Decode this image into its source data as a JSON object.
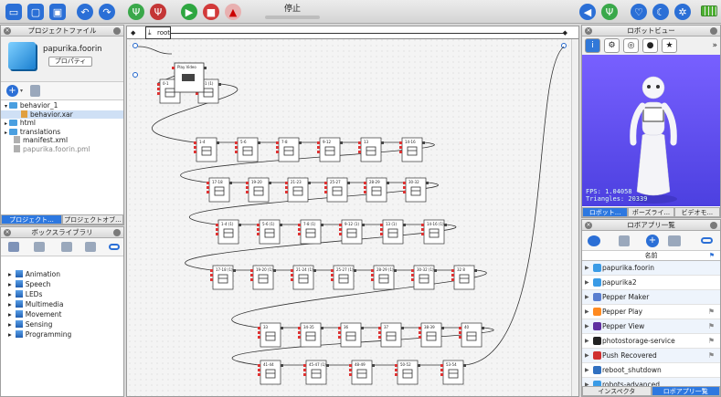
{
  "toolbar": {
    "status_label": "停止",
    "icons": [
      "new-icon",
      "open-icon",
      "save-icon",
      "undo-icon",
      "redo-icon",
      "connect-icon",
      "disconnect-icon",
      "play-icon",
      "stop-icon",
      "warning-icon",
      "volume-icon",
      "robot-icon",
      "heart-icon",
      "sleep-icon",
      "settings-icon",
      "battery-icon"
    ]
  },
  "project_panel": {
    "title": "プロジェクトファイル",
    "name": "papurika.foorin",
    "properties_button": "プロパティ",
    "tree": [
      {
        "label": "behavior_1",
        "type": "folder"
      },
      {
        "label": "behavior.xar",
        "type": "file",
        "selected": true
      },
      {
        "label": "html",
        "type": "folder"
      },
      {
        "label": "translations",
        "type": "folder"
      },
      {
        "label": "manifest.xml",
        "type": "file"
      },
      {
        "label": "papurika.foorin.pml",
        "type": "file"
      }
    ],
    "tabs": [
      "プロジェクト...",
      "プロジェクトオブ..."
    ]
  },
  "box_library": {
    "title": "ボックスライブラリ",
    "items": [
      "Animation",
      "Speech",
      "LEDs",
      "Multimedia",
      "Movement",
      "Sensing",
      "Programming"
    ]
  },
  "canvas": {
    "breadcrumb_root": "root",
    "start_box_label": "Play Video",
    "box_labels": [
      [
        "0-1",
        "0-1 (1)"
      ],
      [
        "1-4",
        "5-6",
        "7-8",
        "9-12",
        "13",
        "14-16"
      ],
      [
        "17-18",
        "19-20",
        "21-23",
        "25-27",
        "28-29",
        "30-32"
      ],
      [
        "1-4 (1)",
        "5-6 (1)",
        "7-8 (1)",
        "9-12 (1)",
        "13 (1)",
        "14-16 (1)"
      ],
      [
        "17-18 (1)",
        "19-20 (1)",
        "21-24 (1)",
        "25-27 (1)",
        "28-29 (1)",
        "30-32 (1)",
        "32 8"
      ],
      [
        "33",
        "34-35",
        "36",
        "37",
        "38-39",
        "40"
      ],
      [
        "41-44",
        "45-47 (1)",
        "48-49",
        "50-52",
        "53-54"
      ]
    ]
  },
  "robot_view": {
    "title": "ロボットビュー",
    "fps": "FPS: 1.04058",
    "triangles": "Triangles: 20339",
    "tabs": [
      "ロボット...",
      "ポーズライ...",
      "ビデオモ..."
    ]
  },
  "robot_apps": {
    "title": "ロボアプリ一覧",
    "column_name": "名前",
    "items": [
      {
        "name": "papurika.foorin",
        "color": "#3a9be6"
      },
      {
        "name": "papurika2",
        "color": "#3a9be6"
      },
      {
        "name": "Pepper Maker",
        "color": "#5a7fd0"
      },
      {
        "name": "Pepper Play",
        "color": "#ff8a20"
      },
      {
        "name": "Pepper View",
        "color": "#6030a0"
      },
      {
        "name": "photostorage-service",
        "color": "#222222"
      },
      {
        "name": "Push Recovered",
        "color": "#d03030"
      },
      {
        "name": "reboot_shutdown",
        "color": "#3070c0"
      },
      {
        "name": "robots-advanced",
        "color": "#3a9be6"
      }
    ],
    "tabs": [
      "インスペクタ",
      "ロボアプリ一覧"
    ]
  }
}
